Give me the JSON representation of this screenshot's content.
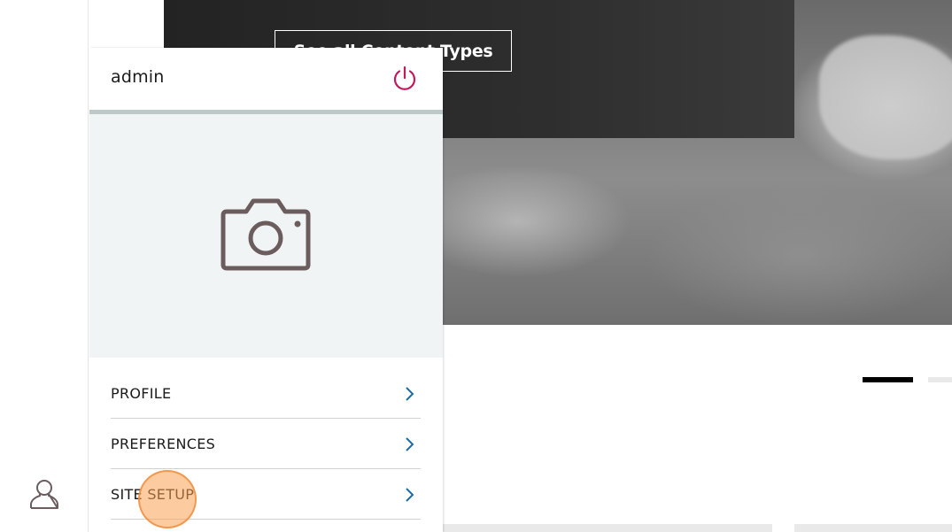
{
  "hero": {
    "button_label": "See all Content Types"
  },
  "user_menu": {
    "username": "admin",
    "items": [
      {
        "label": "PROFILE"
      },
      {
        "label": "PREFERENCES"
      },
      {
        "label": "SITE SETUP"
      }
    ]
  },
  "carousel": {
    "slide_count": 2,
    "active_index": 0
  },
  "icons": {
    "user": "user-icon",
    "power": "power-icon",
    "camera": "camera-icon",
    "chevron": "chevron-right-icon"
  },
  "colors": {
    "power_accent": "#c2185b",
    "chevron": "#1b6aa5",
    "icon_brown": "#6b5d5d",
    "header_rule": "#bcc9c8",
    "avatar_bg": "#f1f4f5"
  }
}
